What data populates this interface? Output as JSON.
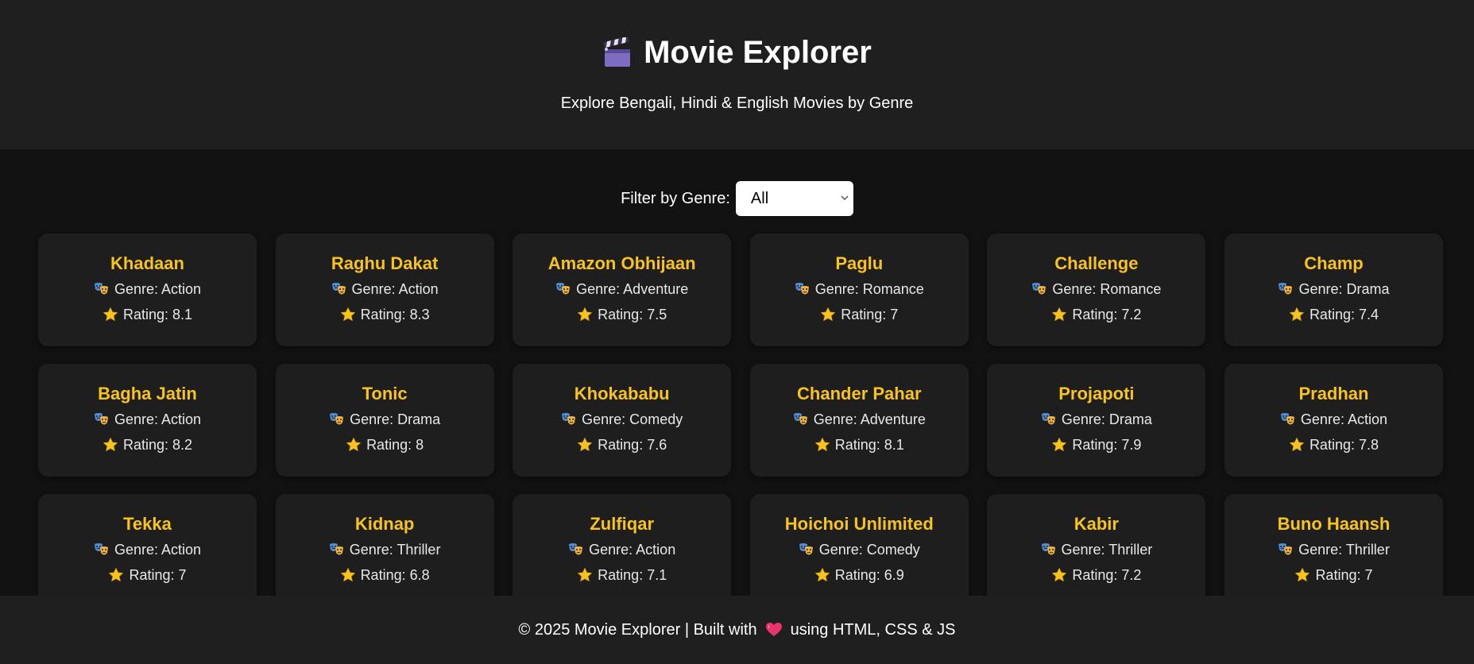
{
  "header": {
    "icon": "clapperboard-icon",
    "title": "Movie Explorer",
    "subtitle": "Explore Bengali, Hindi & English Movies by Genre"
  },
  "filter": {
    "label": "Filter by Genre:",
    "selected": "All"
  },
  "card_labels": {
    "genre_prefix": "Genre: ",
    "rating_prefix": "Rating: "
  },
  "movies": [
    {
      "title": "Khadaan",
      "genre": "Action",
      "rating": "8.1"
    },
    {
      "title": "Raghu Dakat",
      "genre": "Action",
      "rating": "8.3"
    },
    {
      "title": "Amazon Obhijaan",
      "genre": "Adventure",
      "rating": "7.5"
    },
    {
      "title": "Paglu",
      "genre": "Romance",
      "rating": "7"
    },
    {
      "title": "Challenge",
      "genre": "Romance",
      "rating": "7.2"
    },
    {
      "title": "Champ",
      "genre": "Drama",
      "rating": "7.4"
    },
    {
      "title": "Bagha Jatin",
      "genre": "Action",
      "rating": "8.2"
    },
    {
      "title": "Tonic",
      "genre": "Drama",
      "rating": "8"
    },
    {
      "title": "Khokababu",
      "genre": "Comedy",
      "rating": "7.6"
    },
    {
      "title": "Chander Pahar",
      "genre": "Adventure",
      "rating": "8.1"
    },
    {
      "title": "Projapoti",
      "genre": "Drama",
      "rating": "7.9"
    },
    {
      "title": "Pradhan",
      "genre": "Action",
      "rating": "7.8"
    },
    {
      "title": "Tekka",
      "genre": "Action",
      "rating": "7"
    },
    {
      "title": "Kidnap",
      "genre": "Thriller",
      "rating": "6.8"
    },
    {
      "title": "Zulfiqar",
      "genre": "Action",
      "rating": "7.1"
    },
    {
      "title": "Hoichoi Unlimited",
      "genre": "Comedy",
      "rating": "6.9"
    },
    {
      "title": "Kabir",
      "genre": "Thriller",
      "rating": "7.2"
    },
    {
      "title": "Buno Haansh",
      "genre": "Thriller",
      "rating": "7"
    }
  ],
  "footer": {
    "text_before": "© 2025 Movie Explorer | Built with",
    "heart_icon": "heart-icon",
    "text_after": "using HTML, CSS & JS"
  },
  "colors": {
    "accent": "#f7c31c",
    "header_bg": "#1f1f1f",
    "page_bg": "#121212",
    "card_bg": "#1e1e1e"
  }
}
